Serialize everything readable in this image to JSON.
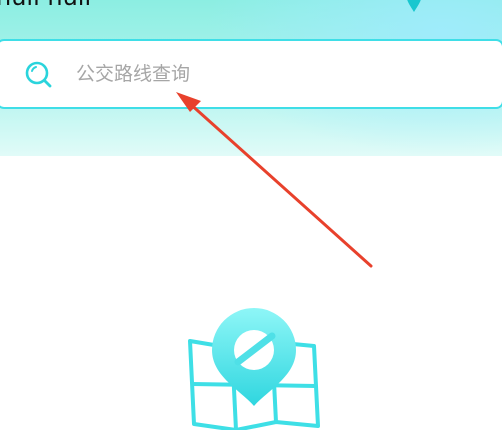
{
  "header": {
    "location_text": "huli huli"
  },
  "search": {
    "placeholder": "公交路线查询",
    "value": ""
  },
  "icons": {
    "search": "search-icon",
    "location": "location-pin-icon",
    "empty_state": "map-pin-illustration"
  },
  "colors": {
    "accent": "#3fdee7",
    "arrow": "#e8412c",
    "header_top": "#8ceee2",
    "header_bottom": "#e1fbf8"
  }
}
